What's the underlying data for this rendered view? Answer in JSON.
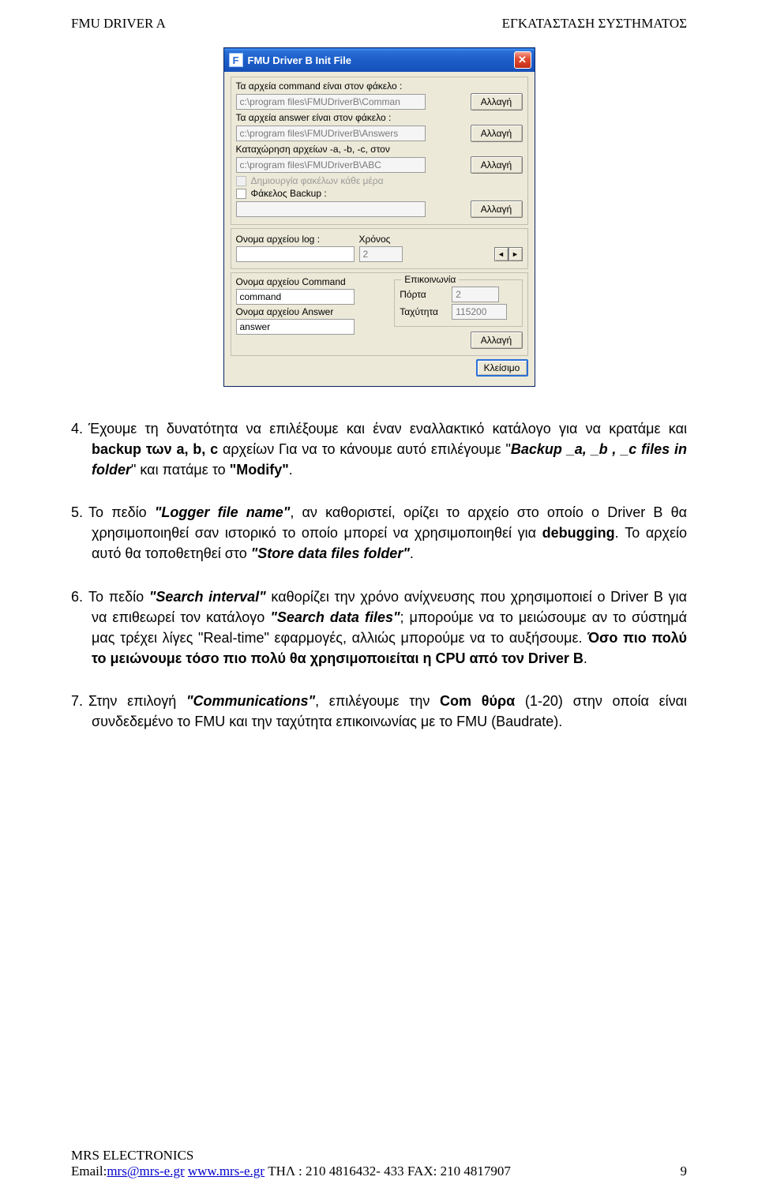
{
  "header": {
    "left": "FMU DRIVER A",
    "right": "ΕΓΚΑΤΑΣΤΑΣΗ ΣΥΣΤΗΜΑΤΟΣ"
  },
  "dialog": {
    "icon_letter": "F",
    "title": "FMU Driver B Init File",
    "close_glyph": "✕",
    "btn_change": "Αλλαγή",
    "btn_close": "Κλείσιμο",
    "lbl_command": "Τα αρχεία command είναι στον φάκελο :",
    "val_command": "c:\\program files\\FMUDriverB\\Comman",
    "lbl_answer": "Τα αρχεία answer είναι στον φάκελο :",
    "val_answer": "c:\\program files\\FMUDriverB\\Answers",
    "lbl_abc": "Καταχώρηση αρχείων -a, -b, -c, στον",
    "val_abc": "c:\\program files\\FMUDriverB\\ABC",
    "chk_daily": "Δημιουργία φακέλων κάθε μέρα",
    "chk_backup": "Φάκελος Backup  :",
    "val_backup": "",
    "lbl_log": "Ονομα αρχείου log :",
    "val_log": "",
    "lbl_time": "Χρόνος",
    "val_time": "2",
    "spin_left": "◄",
    "spin_right": "►",
    "comm_legend": "Επικοινωνία",
    "lbl_port": "Πόρτα",
    "val_port": "2",
    "lbl_speed": "Ταχύτητα",
    "val_speed": "115200",
    "lbl_cmd_file": "Ονομα αρχείου Command",
    "val_cmd_file": "command",
    "lbl_ans_file": "Ονομα αρχείου Answer",
    "val_ans_file": "answer"
  },
  "body": {
    "p4": {
      "num": "4.",
      "t1": "Έχουμε τη δυνατότητα  να επιλέξουμε και έναν εναλλακτικό κατάλογο για να κρατάμε και ",
      "b1": "backup των a, b, c",
      "t2": " αρχείων Για να το κάνουμε αυτό επιλέγουμε \"",
      "i1": "Backup _a, _b , _c files in folder",
      "t3": "\" και πατάμε το ",
      "b2": "\"Modify\"",
      "t4": "."
    },
    "p5": {
      "num": "5.",
      "t1": "Το πεδίο ",
      "i1": "\"Logger file name\"",
      "t2": ", αν καθοριστεί, ορίζει το αρχείο στο οποίο ο Driver B θα χρησιμοποιηθεί σαν ιστορικό το οποίο μπορεί να χρησιμοποιηθεί για ",
      "b1": "debugging",
      "t3": ". Το αρχείο αυτό θα τοποθετηθεί στο ",
      "i2": "\"Store data files folder\"",
      "t4": "."
    },
    "p6": {
      "num": "6.",
      "t1": "Το πεδίο ",
      "i1": "\"Search interval\"",
      "t2": " καθορίζει την χρόνο ανίχνευσης που χρησιμοποιεί ο Driver B για να επιθεωρεί τον κατάλογο  ",
      "i2": "\"Search data files\"",
      "t3": "; μπορούμε να το μειώσουμε αν το σύστημά μας  τρέχει λίγες \"Real-time\" εφαρμογές, αλλιώς μπορούμε να το αυξήσουμε. ",
      "b1": "Όσο πιο πολύ το μειώνουμε τόσο πιο πολύ θα χρησιμοποιείται η CPU από τον Driver B",
      "t4": "."
    },
    "p7": {
      "num": "7.",
      "t1": "Στην  επιλογή ",
      "i1": "\"Communications\"",
      "t2": ", επιλέγουμε την ",
      "b1": "Com θύρα",
      "t3": " (1-20) στην οποία είναι συνδεδεμένο το FMU και την ταχύτητα επικοινωνίας με το FMU (Baudrate)."
    }
  },
  "footer": {
    "line1": "MRS ELECTRONICS",
    "email_lbl": "Email:",
    "email": "mrs@mrs-e.gr",
    "sep": "  ",
    "url": "www.mrs-e.gr",
    "tail": "  ΤΗΛ : 210  4816432- 433  FAX: 210 4817907",
    "page": "9"
  }
}
